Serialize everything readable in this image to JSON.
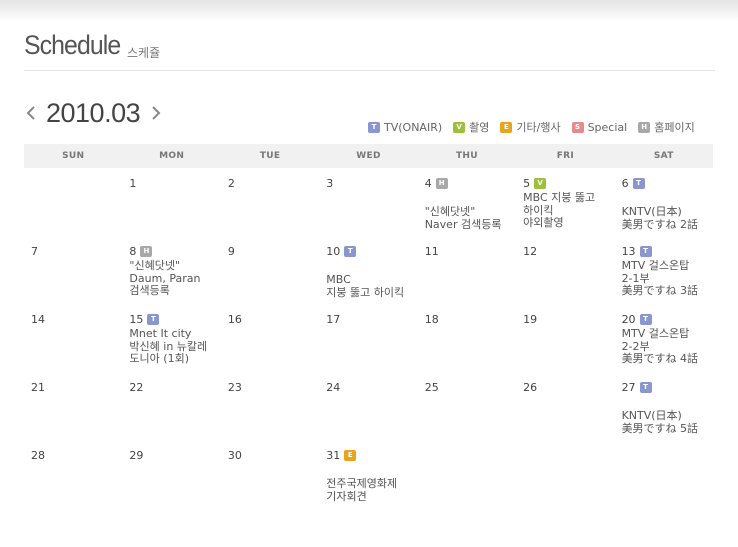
{
  "header": {
    "title_en": "Schedule",
    "title_ko": "스케쥴"
  },
  "month": {
    "label": "2010.03",
    "prev_icon": "chevron-left-icon",
    "next_icon": "chevron-right-icon"
  },
  "legend": [
    {
      "code": "T",
      "label": "TV(ONAIR)",
      "color": "#8a96cf"
    },
    {
      "code": "V",
      "label": "촬영",
      "color": "#9bc03a"
    },
    {
      "code": "E",
      "label": "기타/행사",
      "color": "#e8a51b"
    },
    {
      "code": "S",
      "label": "Special",
      "color": "#e88a8a"
    },
    {
      "code": "H",
      "label": "홈페이지",
      "color": "#a8a8a8"
    }
  ],
  "weekdays": [
    "SUN",
    "MON",
    "TUE",
    "WED",
    "THU",
    "FRI",
    "SAT"
  ],
  "weeks": [
    [
      {
        "num": "",
        "badge": "",
        "event": ""
      },
      {
        "num": "1",
        "badge": "",
        "event": ""
      },
      {
        "num": "2",
        "badge": "",
        "event": ""
      },
      {
        "num": "3",
        "badge": "",
        "event": ""
      },
      {
        "num": "4",
        "badge": "H",
        "event": "\"신혜닷넷\"\nNaver 검색등록",
        "low": true
      },
      {
        "num": "5",
        "badge": "V",
        "event": "MBC 지붕 뚫고\n하이킥\n야외촬영"
      },
      {
        "num": "6",
        "badge": "T",
        "event": "KNTV(日本)\n美男ですね 2話",
        "low": true
      }
    ],
    [
      {
        "num": "7",
        "badge": "",
        "event": ""
      },
      {
        "num": "8",
        "badge": "H",
        "event": "\"신혜닷넷\"\nDaum, Paran\n검색등록"
      },
      {
        "num": "9",
        "badge": "",
        "event": ""
      },
      {
        "num": "10",
        "badge": "T",
        "event": "MBC\n지붕 뚫고 하이킥",
        "low": true
      },
      {
        "num": "11",
        "badge": "",
        "event": ""
      },
      {
        "num": "12",
        "badge": "",
        "event": ""
      },
      {
        "num": "13",
        "badge": "T",
        "event": "MTV 걸스온탑\n2-1부\n美男ですね 3話"
      }
    ],
    [
      {
        "num": "14",
        "badge": "",
        "event": ""
      },
      {
        "num": "15",
        "badge": "T",
        "event": "Mnet It city\n박신혜 in 뉴칼레\n도니아 (1회)"
      },
      {
        "num": "16",
        "badge": "",
        "event": ""
      },
      {
        "num": "17",
        "badge": "",
        "event": ""
      },
      {
        "num": "18",
        "badge": "",
        "event": ""
      },
      {
        "num": "19",
        "badge": "",
        "event": ""
      },
      {
        "num": "20",
        "badge": "T",
        "event": "MTV 걸스온탑\n2-2부\n美男ですね 4話"
      }
    ],
    [
      {
        "num": "21",
        "badge": "",
        "event": ""
      },
      {
        "num": "22",
        "badge": "",
        "event": ""
      },
      {
        "num": "23",
        "badge": "",
        "event": ""
      },
      {
        "num": "24",
        "badge": "",
        "event": ""
      },
      {
        "num": "25",
        "badge": "",
        "event": ""
      },
      {
        "num": "26",
        "badge": "",
        "event": ""
      },
      {
        "num": "27",
        "badge": "T",
        "event": "KNTV(日本)\n美男ですね 5話",
        "low": true
      }
    ],
    [
      {
        "num": "28",
        "badge": "",
        "event": ""
      },
      {
        "num": "29",
        "badge": "",
        "event": ""
      },
      {
        "num": "30",
        "badge": "",
        "event": ""
      },
      {
        "num": "31",
        "badge": "E",
        "event": "전주국제영화제\n기자회견",
        "low": true
      },
      {
        "num": "",
        "badge": "",
        "event": ""
      },
      {
        "num": "",
        "badge": "",
        "event": ""
      },
      {
        "num": "",
        "badge": "",
        "event": ""
      }
    ]
  ]
}
